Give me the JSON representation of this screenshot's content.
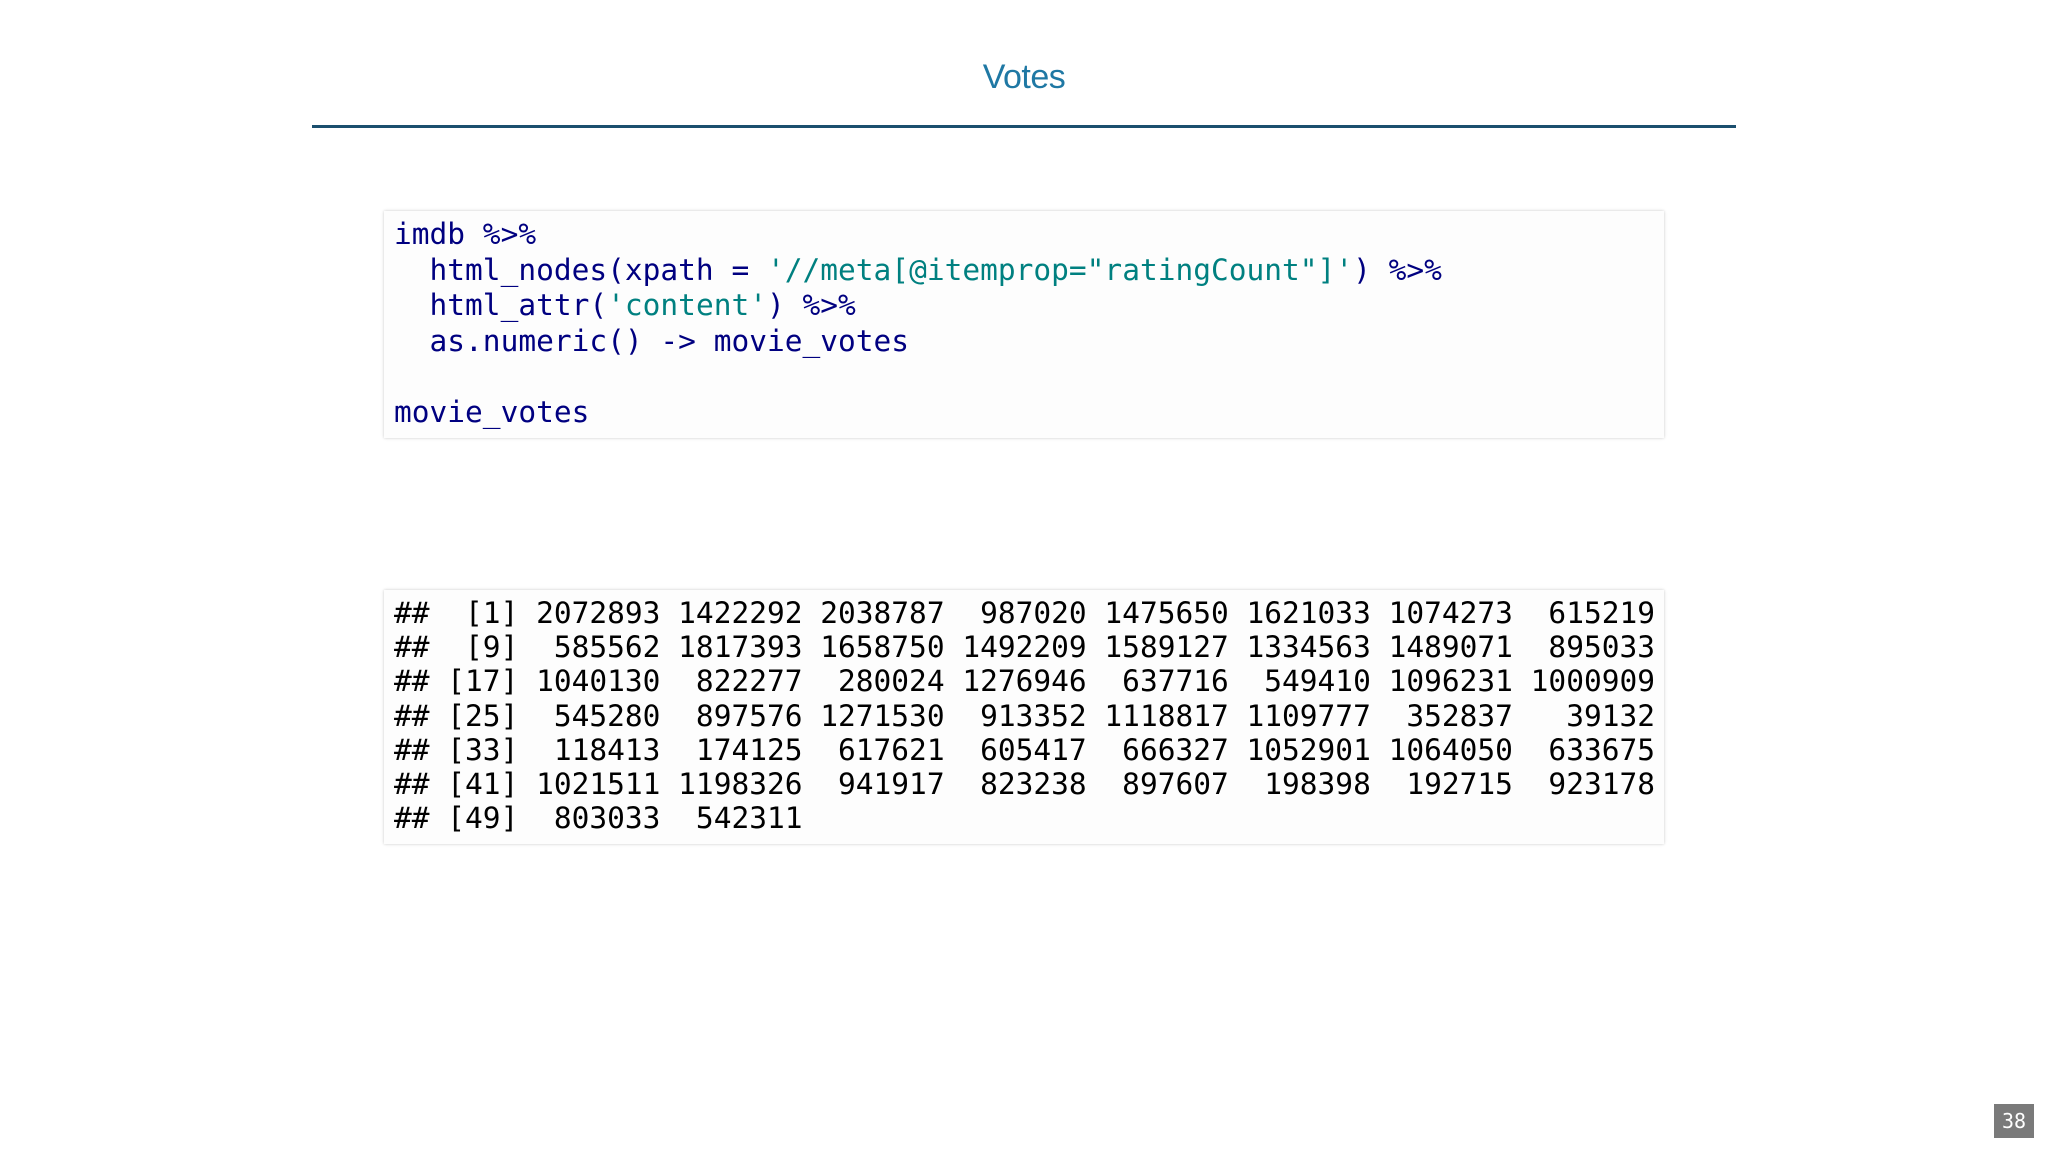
{
  "slide": {
    "title": "Votes",
    "page_number": "38"
  },
  "source_code": {
    "line1": "imdb %>%",
    "line2_pre": "  html_nodes(xpath = ",
    "line2_str": "'//meta[@itemprop=\"ratingCount\"]'",
    "line2_post": ") %>%",
    "line3_pre": "  html_attr(",
    "line3_str": "'content'",
    "line3_post": ") %>%",
    "line4": "  as.numeric() -> movie_votes",
    "line5": "",
    "line6": "movie_votes"
  },
  "output": {
    "lines": [
      "##  [1] 2072893 1422292 2038787  987020 1475650 1621033 1074273  615219",
      "##  [9]  585562 1817393 1658750 1492209 1589127 1334563 1489071  895033",
      "## [17] 1040130  822277  280024 1276946  637716  549410 1096231 1000909",
      "## [25]  545280  897576 1271530  913352 1118817 1109777  352837   39132",
      "## [33]  118413  174125  617621  605417  666327 1052901 1064050  633675",
      "## [41] 1021511 1198326  941917  823238  897607  198398  192715  923178",
      "## [49]  803033  542311"
    ]
  },
  "colors": {
    "title": "#1f78a4",
    "rule": "#1b4f6e",
    "code_text": "#000080",
    "string_literal": "#008080",
    "page_badge": "#7a7a7a"
  }
}
